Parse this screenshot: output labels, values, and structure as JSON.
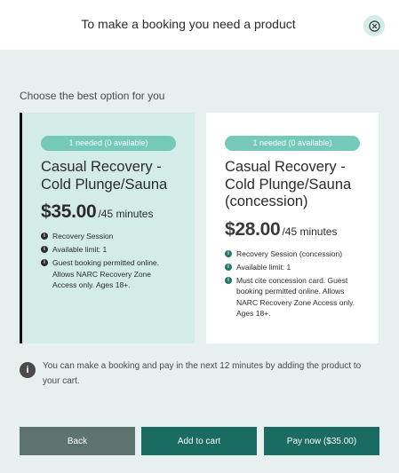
{
  "header": {
    "title": "To make a booking you need a product",
    "close_icon": "close-circle-icon"
  },
  "subtitle": "Choose the best option for you",
  "products": [
    {
      "availability": "1 needed (0 available)",
      "title_line1": "Casual Recovery -",
      "title_line2": "Cold Plunge/Sauna",
      "price": "$35.00",
      "per": "/45 minutes",
      "features": [
        "Recovery Session",
        "Available limit: 1",
        "Guest booking permitted online. Allows NARC Recovery Zone Access only. Ages 18+."
      ]
    },
    {
      "availability": "1 needed (0 available)",
      "title_line1": "Casual Recovery -",
      "title_line2": "Cold Plunge/Sauna",
      "title_line3": "(concession)",
      "price": "$28.00",
      "per": "/45 minutes",
      "features": [
        "Recovery Session (concession)",
        "Available limit: 1",
        "Must cite concession card. Guest booking permitted online. Allows NARC Recovery Zone Access only. Ages 18+."
      ]
    }
  ],
  "info": {
    "icon": "info-icon",
    "text": "You can make a booking and pay in the next 12 minutes by adding the product to your cart."
  },
  "buttons": {
    "back": "Back",
    "add_to_cart": "Add to cart",
    "pay_now": "Pay now ($35.00)"
  },
  "colors": {
    "accent": "#1a6c62",
    "pill": "#74c9b8",
    "selected_card": "#d4ece7",
    "background": "#e7f0ee",
    "back_button": "#5e736d"
  }
}
